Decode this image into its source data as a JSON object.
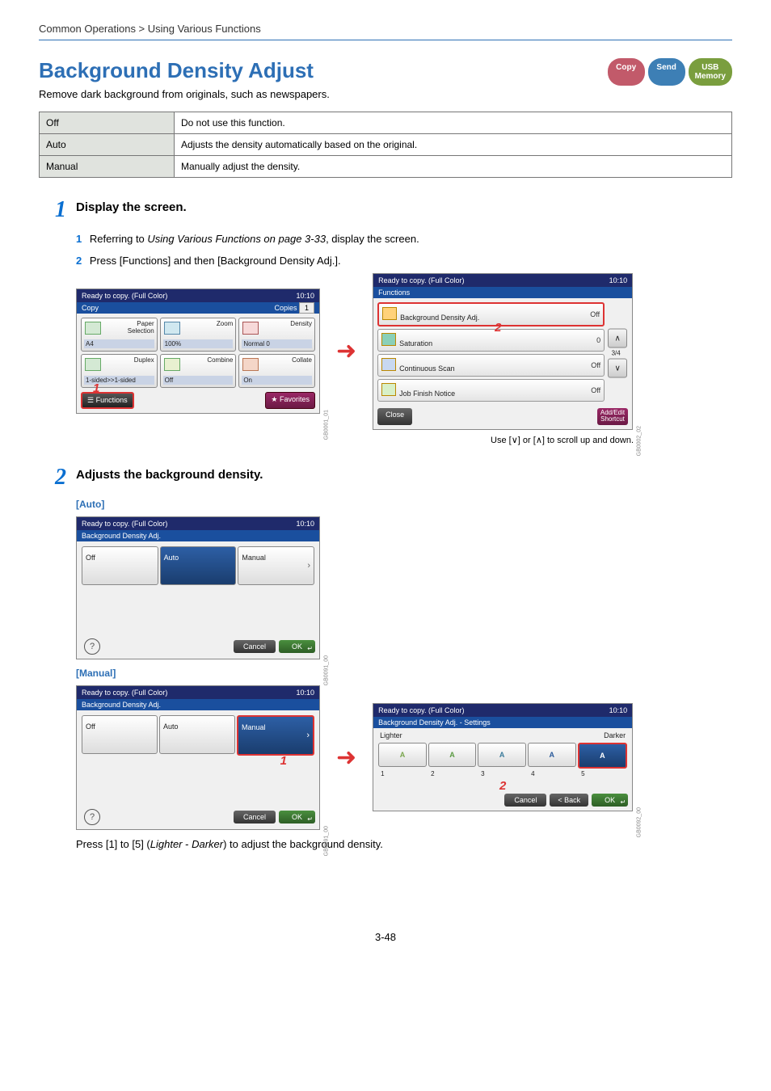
{
  "breadcrumb": "Common Operations > Using Various Functions",
  "title": "Background Density Adjust",
  "subtitle": "Remove dark background from originals, such as newspapers.",
  "pills": {
    "copy": "Copy",
    "send": "Send",
    "usb": "USB\nMemory"
  },
  "options": [
    {
      "name": "Off",
      "desc": "Do not use this function."
    },
    {
      "name": "Auto",
      "desc": "Adjusts the density automatically based on the original."
    },
    {
      "name": "Manual",
      "desc": "Manually adjust the density."
    }
  ],
  "step1": {
    "num": "1",
    "title": "Display the screen.",
    "sub1_n": "1",
    "sub1_a": "Referring to ",
    "sub1_b": "Using Various Functions on page 3-33",
    "sub1_c": ", display the screen.",
    "sub2_n": "2",
    "sub2": "Press [Functions] and then [Background Density Adj.]."
  },
  "panelA": {
    "hdr": "Ready to copy. (Full Color)",
    "time": "10:10",
    "mode": "Copy",
    "copies_label": "Copies",
    "copies_val": "1",
    "tiles": [
      {
        "name": "Paper\nSelection",
        "val": "A4"
      },
      {
        "name": "Zoom",
        "val": "100%"
      },
      {
        "name": "Density",
        "val": "Normal 0"
      },
      {
        "name": "Duplex",
        "val": "1-sided>>1-sided"
      },
      {
        "name": "Combine",
        "val": "Off"
      },
      {
        "name": "Collate",
        "val": "On"
      }
    ],
    "functions": "Functions",
    "favorites": "Favorites",
    "code": "GB0001_01",
    "mark": "1"
  },
  "panelB": {
    "hdr": "Ready to copy. (Full Color)",
    "time": "10:10",
    "mode": "Functions",
    "rows": [
      {
        "name": "Background Density Adj.",
        "val": "Off",
        "sel": true
      },
      {
        "name": "Saturation",
        "val": "0"
      },
      {
        "name": "Continuous Scan",
        "val": "Off"
      },
      {
        "name": "Job Finish Notice",
        "val": "Off"
      }
    ],
    "page": "3/4",
    "close": "Close",
    "addedit": "Add/Edit\nShortcut",
    "code": "GB0002_02",
    "mark": "2"
  },
  "scroll_note_a": "Use [",
  "scroll_note_b": "] or [",
  "scroll_note_c": "] to scroll up and down.",
  "step2": {
    "num": "2",
    "title": "Adjusts the background density."
  },
  "auto_label": "[Auto]",
  "manual_label": "[Manual]",
  "panelC": {
    "hdr": "Ready to copy. (Full Color)",
    "time": "10:10",
    "mode": "Background Density Adj.",
    "btns": [
      "Off",
      "Auto",
      "Manual"
    ],
    "sel": 1,
    "cancel": "Cancel",
    "ok": "OK",
    "code": "GB0091_00"
  },
  "panelD": {
    "hdr": "Ready to copy. (Full Color)",
    "time": "10:10",
    "mode": "Background Density Adj.",
    "btns": [
      "Off",
      "Auto",
      "Manual"
    ],
    "sel": 2,
    "cancel": "Cancel",
    "ok": "OK",
    "code": "GB0091_00",
    "mark": "1"
  },
  "panelE": {
    "hdr": "Ready to copy. (Full Color)",
    "time": "10:10",
    "mode": "Background Density Adj. - Settings",
    "lighter": "Lighter",
    "darker": "Darker",
    "nums": [
      "1",
      "2",
      "3",
      "4",
      "5"
    ],
    "sel": 4,
    "cancel": "Cancel",
    "back": "< Back",
    "ok": "OK",
    "code": "GB0092_00",
    "mark": "2"
  },
  "footnote_a": "Press [1] to [5] (",
  "footnote_b": "Lighter",
  "footnote_c": " - ",
  "footnote_d": "Darker",
  "footnote_e": ") to adjust the background density.",
  "pagenum": "3-48"
}
